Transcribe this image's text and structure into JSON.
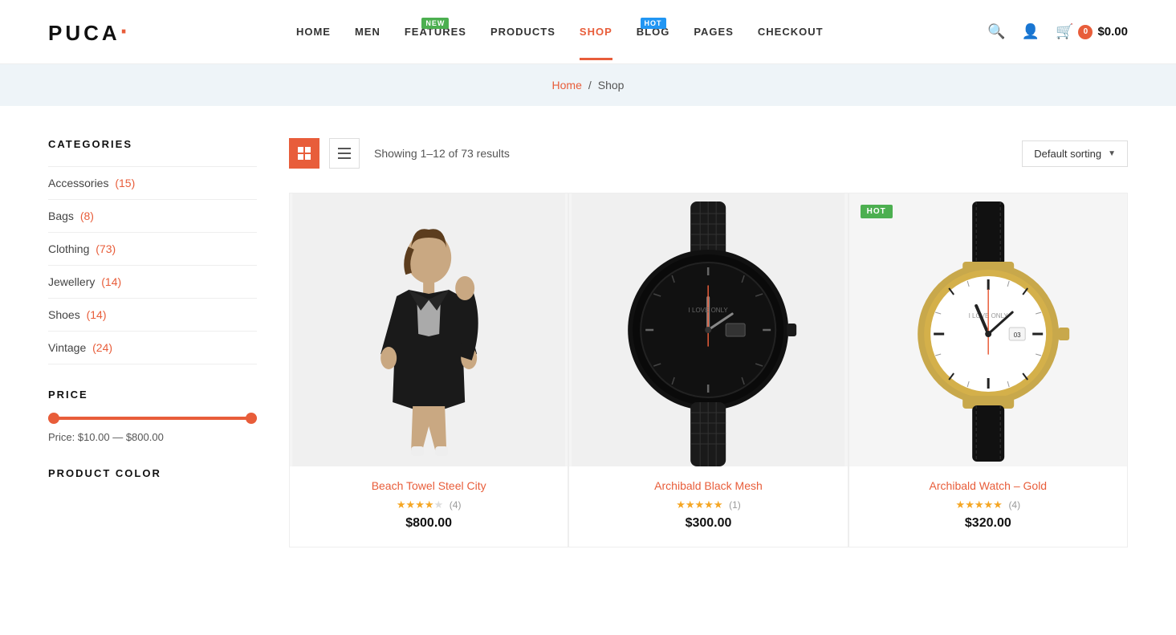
{
  "header": {
    "logo": "PUCA",
    "nav": [
      {
        "label": "HOME",
        "active": false,
        "badge": null
      },
      {
        "label": "MEN",
        "active": false,
        "badge": null
      },
      {
        "label": "FEATURES",
        "active": false,
        "badge": {
          "text": "NEW",
          "type": "green"
        }
      },
      {
        "label": "PRODUCTS",
        "active": false,
        "badge": null
      },
      {
        "label": "SHOP",
        "active": true,
        "badge": null
      },
      {
        "label": "BLOG",
        "active": false,
        "badge": {
          "text": "HOT",
          "type": "blue"
        }
      },
      {
        "label": "PAGES",
        "active": false,
        "badge": null
      },
      {
        "label": "CHECKOUT",
        "active": false,
        "badge": null
      }
    ],
    "cart_count": "0",
    "cart_total": "$0.00"
  },
  "breadcrumb": {
    "home_label": "Home",
    "separator": "/",
    "current": "Shop"
  },
  "sidebar": {
    "categories_title": "CATEGORIES",
    "categories": [
      {
        "name": "Accessories",
        "count": "(15)"
      },
      {
        "name": "Bags",
        "count": "(8)"
      },
      {
        "name": "Clothing",
        "count": "(73)"
      },
      {
        "name": "Jewellery",
        "count": "(14)"
      },
      {
        "name": "Shoes",
        "count": "(14)"
      },
      {
        "name": "Vintage",
        "count": "(24)"
      }
    ],
    "price_title": "PRICE",
    "price_label": "Price: $10.00 — $800.00",
    "price_min": "$10.00",
    "price_max": "$800.00",
    "product_color_title": "PRODUCT COLOR"
  },
  "toolbar": {
    "results_text": "Showing 1–12 of 73 results",
    "sort_label": "Default sorting"
  },
  "products": [
    {
      "name": "Beach Towel Steel City",
      "price": "$800.00",
      "stars": 4,
      "review_count": "(4)",
      "hot_badge": false,
      "type": "clothing"
    },
    {
      "name": "Archibald Black Mesh",
      "price": "$300.00",
      "stars": 5,
      "review_count": "(1)",
      "hot_badge": false,
      "type": "watch_black"
    },
    {
      "name": "Archibald Watch – Gold",
      "price": "$320.00",
      "stars": 5,
      "review_count": "(4)",
      "hot_badge": true,
      "type": "watch_gold"
    }
  ]
}
